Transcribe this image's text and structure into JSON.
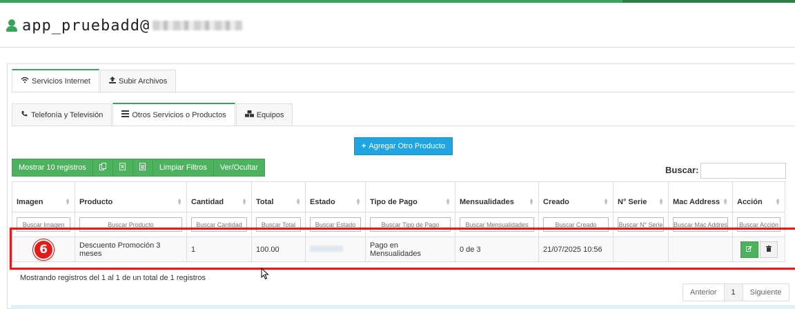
{
  "header": {
    "username": "app_pruebadd@"
  },
  "tabs_top": [
    {
      "label": "Servicios Internet",
      "icon": "wifi-icon",
      "active": true
    },
    {
      "label": "Subir Archivos",
      "icon": "upload-icon",
      "active": false
    }
  ],
  "tabs_sub": [
    {
      "label": "Telefonía y Televisión",
      "icon": "phone-tv-icon",
      "active": false
    },
    {
      "label": "Otros Servicios o Productos",
      "icon": "list-icon",
      "active": true
    },
    {
      "label": "Equipos",
      "icon": "cubes-icon",
      "active": false
    }
  ],
  "add_button": "Agregar Otro Producto",
  "toolbar": {
    "show_label": "Mostrar 10 registros",
    "copy_icon": "copy-icon",
    "excel_icon": "excel-icon",
    "print_icon": "file-icon",
    "clear_label": "Limpiar Filtros",
    "toggle_label": "Ver/Ocultar"
  },
  "search": {
    "label": "Buscar:",
    "value": ""
  },
  "table": {
    "columns": [
      "Imagen",
      "Producto",
      "Cantidad",
      "Total",
      "Estado",
      "Tipo de Pago",
      "Mensualidades",
      "Creado",
      "N° Serie",
      "Mac Address",
      "Acción"
    ],
    "filters": [
      "Buscar Imagen",
      "Buscar Producto",
      "Buscar Cantidad",
      "Buscar Total",
      "Buscar Estado",
      "Buscar Tipo de Pago",
      "Buscar Mensualidades",
      "Buscar Creado",
      "Buscar N° Serie",
      "Buscar Mac Address",
      "Buscar Acción"
    ],
    "rows": [
      {
        "imagen": "",
        "producto": "Descuento Promoción 3 meses",
        "cantidad": "1",
        "total": "100.00",
        "estado": "",
        "tipo_pago": "Pago en Mensualidades",
        "mensualidades": "0 de 3",
        "creado": "21/07/2025 10:56",
        "serie": "",
        "mac": ""
      }
    ]
  },
  "annotation": {
    "badge": "6",
    "color": "#e21b1b"
  },
  "info_text": "Mostrando registros del 1 al 1 de un total de 1 registros",
  "pager": {
    "prev": "Anterior",
    "current": "1",
    "next": "Siguiente"
  },
  "colors": {
    "accent_green": "#3aa35b",
    "button_green": "#4cb25e",
    "button_blue": "#1fa6e0"
  }
}
